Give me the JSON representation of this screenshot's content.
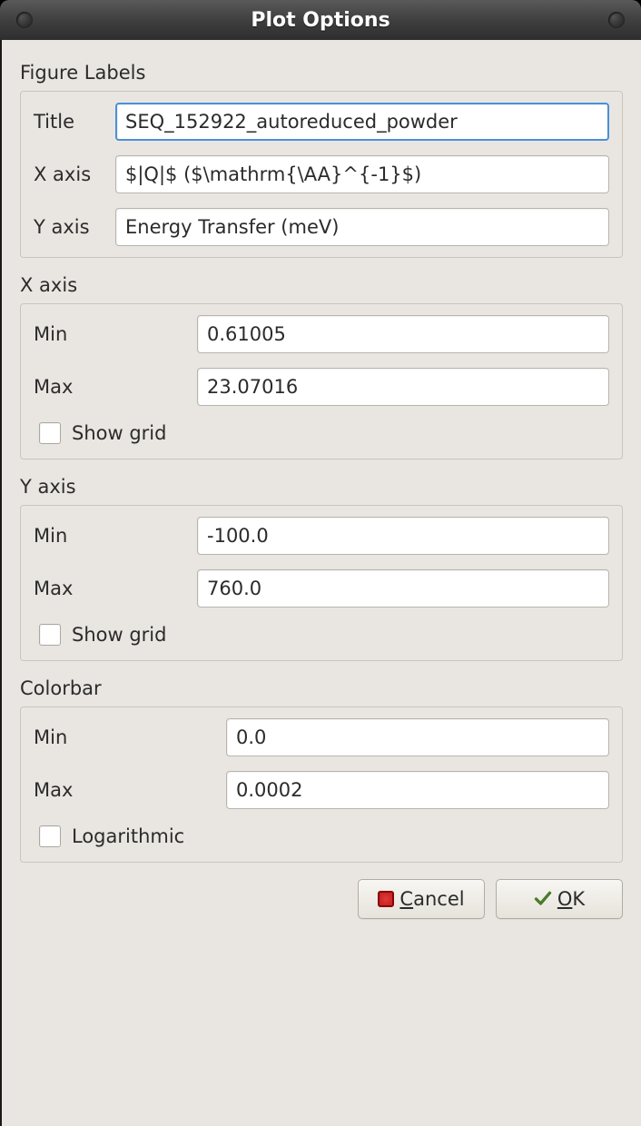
{
  "window": {
    "title": "Plot Options"
  },
  "section_labels": {
    "figure_labels": "Figure Labels",
    "x_axis": "X axis",
    "y_axis": "Y axis",
    "colorbar": "Colorbar"
  },
  "figure_labels": {
    "title_label": "Title",
    "title_value": "SEQ_152922_autoreduced_powder",
    "x_label": "X axis",
    "x_value": "$|Q|$ ($\\mathrm{\\AA}^{-1}$)",
    "y_label": "Y axis",
    "y_value": "Energy Transfer (meV)"
  },
  "x_axis": {
    "min_label": "Min",
    "min_value": "0.61005",
    "max_label": "Max",
    "max_value": "23.07016",
    "show_grid_label": "Show grid",
    "show_grid_checked": false
  },
  "y_axis": {
    "min_label": "Min",
    "min_value": "-100.0",
    "max_label": "Max",
    "max_value": "760.0",
    "show_grid_label": "Show grid",
    "show_grid_checked": false
  },
  "colorbar": {
    "min_label": "Min",
    "min_value": "0.0",
    "max_label": "Max",
    "max_value": "0.0002",
    "logarithmic_label": "Logarithmic",
    "logarithmic_checked": false
  },
  "buttons": {
    "cancel": "Cancel",
    "ok": "OK"
  }
}
